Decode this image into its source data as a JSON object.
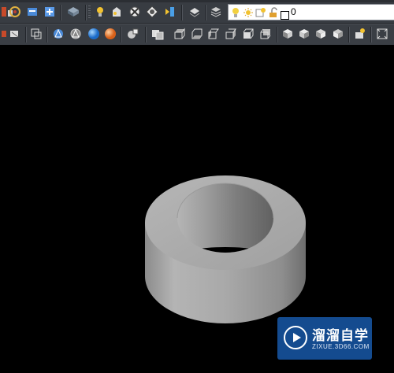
{
  "toolbar1": {
    "icons": [
      "target-icon",
      "layer-manager-icon",
      "layer-states-icon",
      "layer-previous-icon",
      "lightbulb-icon",
      "freeze-icon",
      "render-icon",
      "sun-icon",
      "lightbulb-blue-icon",
      "lock-icon",
      "layer-list-icon"
    ],
    "layer_field": {
      "label": "0",
      "icons": [
        "layer-on-icon",
        "layer-freeze-icon",
        "layer-viewport-icon",
        "layer-unlock-icon",
        "layer-color-swatch-icon"
      ]
    }
  },
  "toolbar2": {
    "icons": [
      "orbit-icon",
      "render-wire-icon",
      "region-icon",
      "hidden-style-icon",
      "wireframe-icon",
      "realistic-icon",
      "conceptual-icon",
      "visual-styles-icon",
      "named-views-icon",
      "top-view-icon",
      "bottom-view-icon",
      "left-view-icon",
      "right-view-icon",
      "front-view-icon",
      "back-view-icon",
      "sw-iso-icon",
      "se-iso-icon",
      "ne-iso-icon",
      "nw-iso-icon",
      "camera-icon",
      "viewport-icon"
    ]
  },
  "viewport": {
    "model": "cylinder-ring-model"
  },
  "watermark": {
    "name": "溜溜自学",
    "url": "ZIXUE.3D66.COM"
  }
}
